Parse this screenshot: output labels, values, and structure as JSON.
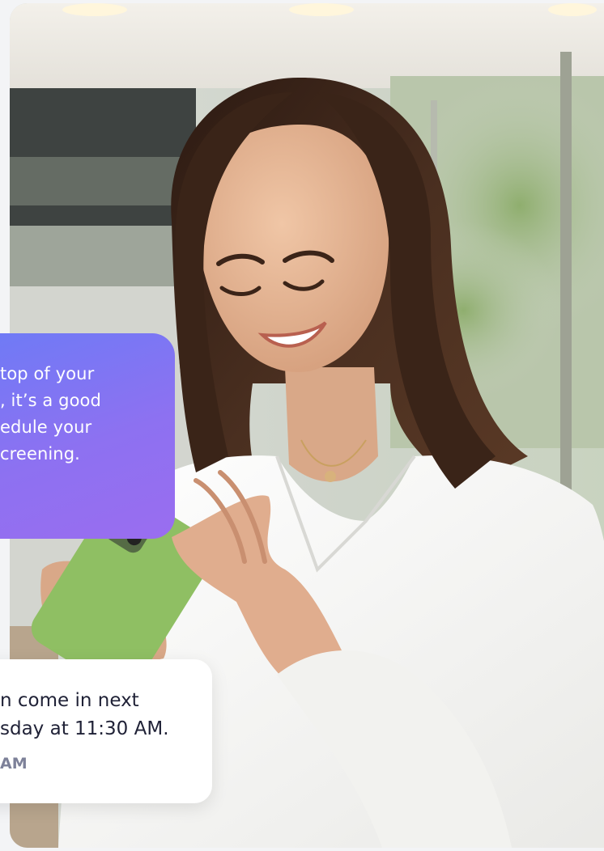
{
  "photo": {
    "subject": "smiling-woman-with-phone"
  },
  "bubble_purple": {
    "lines": [
      "top of your",
      ", it’s a good",
      "edule your",
      "creening."
    ],
    "gradient_start": "#6d7bf6",
    "gradient_end": "#9a6df0"
  },
  "bubble_white": {
    "lines": [
      "n come in next",
      "sday at 11:30 AM."
    ],
    "time": "AM"
  },
  "colors": {
    "text_dark": "#1f2136",
    "text_muted": "#7d8199",
    "shirt": "#f4f4f2",
    "phone": "#8fbf63",
    "hair": "#3a2418",
    "skin": "#e3b594"
  }
}
